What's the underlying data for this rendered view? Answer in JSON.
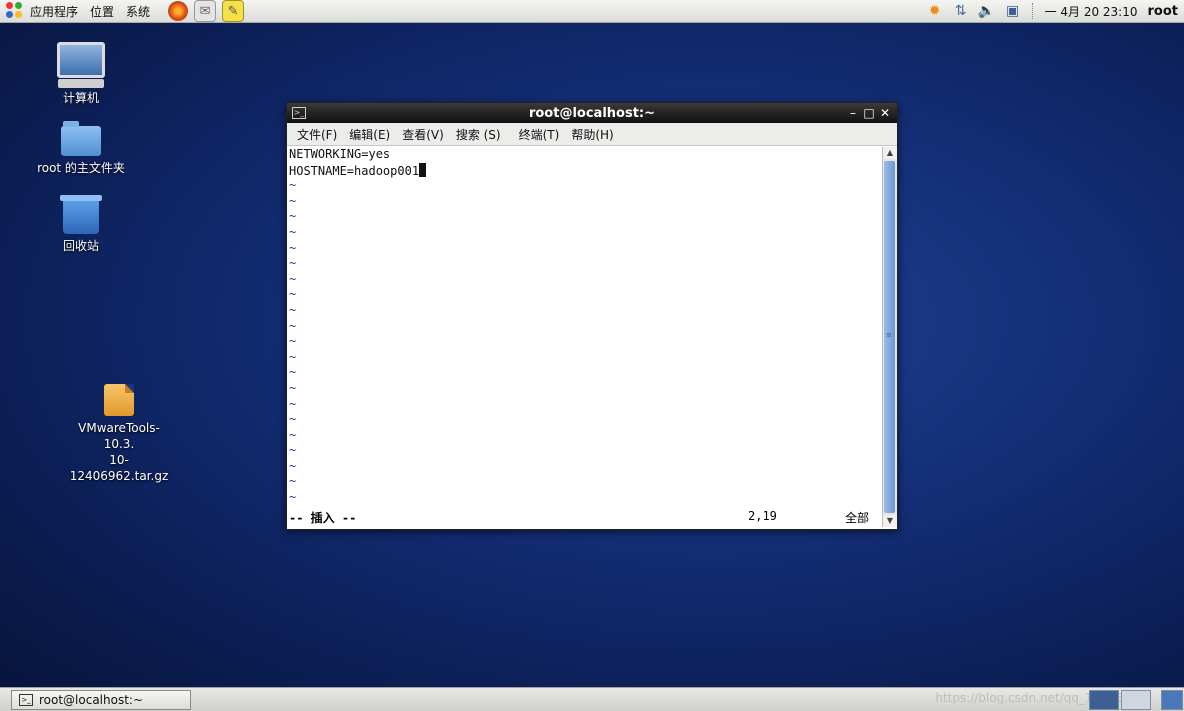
{
  "top_panel": {
    "menus": [
      "应用程序",
      "位置",
      "系统"
    ],
    "clock": "一 4月 20 23:10",
    "user": "root"
  },
  "desktop": {
    "icons": [
      {
        "label": "计算机"
      },
      {
        "label": "root 的主文件夹"
      },
      {
        "label": "回收站"
      },
      {
        "label": "VMwareTools-10.3.\n10-12406962.tar.gz"
      }
    ]
  },
  "window": {
    "title": "root@localhost:~",
    "menus": [
      "文件(F)",
      "编辑(E)",
      "查看(V)",
      "搜索 (S)",
      "终端(T)",
      "帮助(H)"
    ],
    "lines": [
      "NETWORKING=yes",
      "HOSTNAME=hadoop001"
    ],
    "tilde": "~",
    "status_mode": "-- 插入 --",
    "status_position": "2,19",
    "status_all": "全部"
  },
  "taskbar": {
    "task_label": "root@localhost:~",
    "watermark": "https://blog.csdn.net/qq_16146103"
  },
  "colors": {
    "desktop_bg": "#15307a",
    "titlebar": "#1a1a1a",
    "scroll_thumb": "#6c97d6"
  }
}
